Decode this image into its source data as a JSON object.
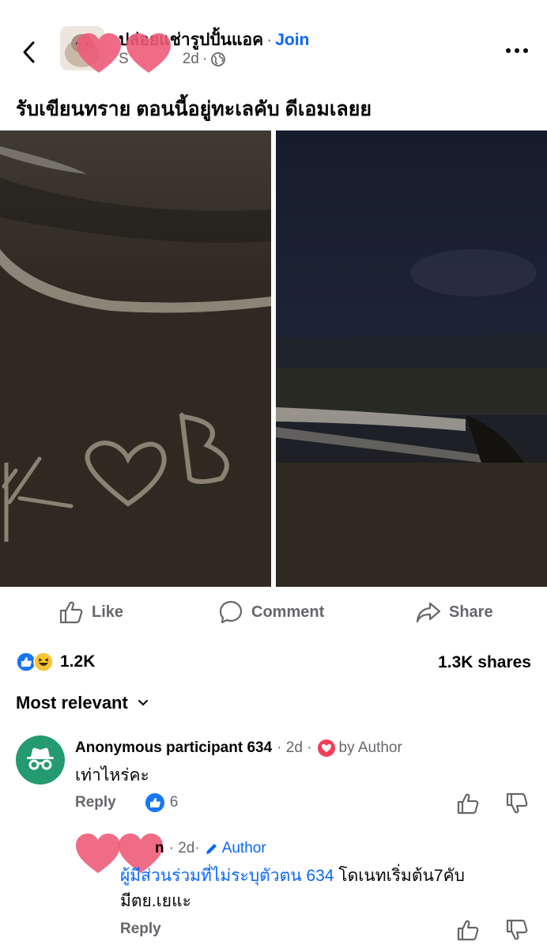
{
  "post": {
    "group_name": "ปล่อยแช่ารูปปั้นแอค",
    "join_label": "Join",
    "author_initial": "S",
    "time": "2d",
    "caption": "รับเขียนทราย ตอนนี้อยู่ทะเลคับ ดีเอมเลยย"
  },
  "actions": {
    "like": "Like",
    "comment": "Comment",
    "share": "Share"
  },
  "stats": {
    "reactions": "1.2K",
    "shares": "1.3K shares"
  },
  "sort": {
    "label": "Most relevant"
  },
  "comments": [
    {
      "author": "Anonymous participant 634",
      "time": "2d",
      "badge": "by Author",
      "text": "เท่าไหร่คะ",
      "reply_label": "Reply",
      "likes": "6"
    }
  ],
  "reply": {
    "author_suffix": "n",
    "time": "2d",
    "role": "Author",
    "mention": "ผู้มีส่วนร่วมที่ไม่ระบุตัวตน 634",
    "text": " โดเนทเริ่มต้น7คับ มีตย.เยแะ",
    "reply_label": "Reply"
  },
  "colors": {
    "accent": "#0866ff",
    "secondary_text": "#65676b",
    "heart_sticker": "#ee5b79",
    "anon_avatar": "#239a70"
  },
  "icons": [
    "back-icon",
    "more-icon",
    "globe-icon",
    "like-icon",
    "comment-icon",
    "share-icon",
    "chevron-down-icon",
    "anonymous-icon",
    "heart-badge-icon",
    "pencil-icon",
    "thumbs-up-icon",
    "thumbs-down-icon"
  ]
}
